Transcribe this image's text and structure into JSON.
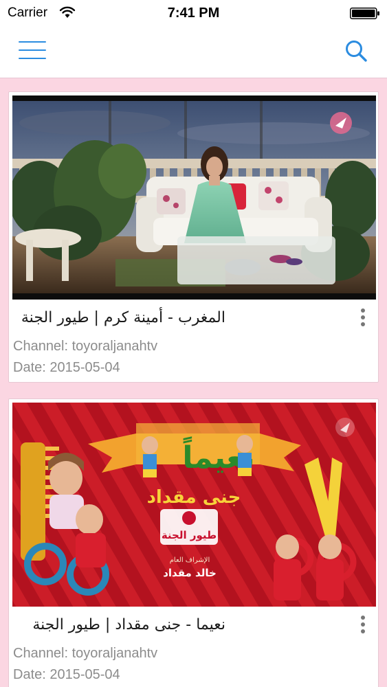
{
  "status_bar": {
    "carrier": "Carrier",
    "time": "7:41 PM",
    "wifi_icon": "wifi-icon",
    "battery_icon": "battery-icon"
  },
  "nav_bar": {
    "menu_icon": "hamburger-menu-icon",
    "search_icon": "search-icon",
    "accent_color": "#2b8ce0"
  },
  "background_color": "#fbd6e2",
  "videos": [
    {
      "title": "المغرب - أمينة كرم | طيور الجنة",
      "channel": "Channel: toyoraljanahtv",
      "date": "Date: 2015-05-04",
      "thumbnail": "photo of a woman in a green dress seated on a white sofa on a balcony terrace with plants"
    },
    {
      "title": "نعيما - جنى مقداد | طيور الجنة",
      "channel": "Channel: toyoraljanahtv",
      "date": "Date: 2015-05-04",
      "thumbnail": "red striped poster with children, giant comb and scissors",
      "poster_title": "نعيماً",
      "poster_subtitle": "جنى مقداد",
      "poster_logo": "طيور الجنة",
      "poster_credit_label": "الإشراف العام",
      "poster_credit_name": "خالد مقداد"
    }
  ]
}
